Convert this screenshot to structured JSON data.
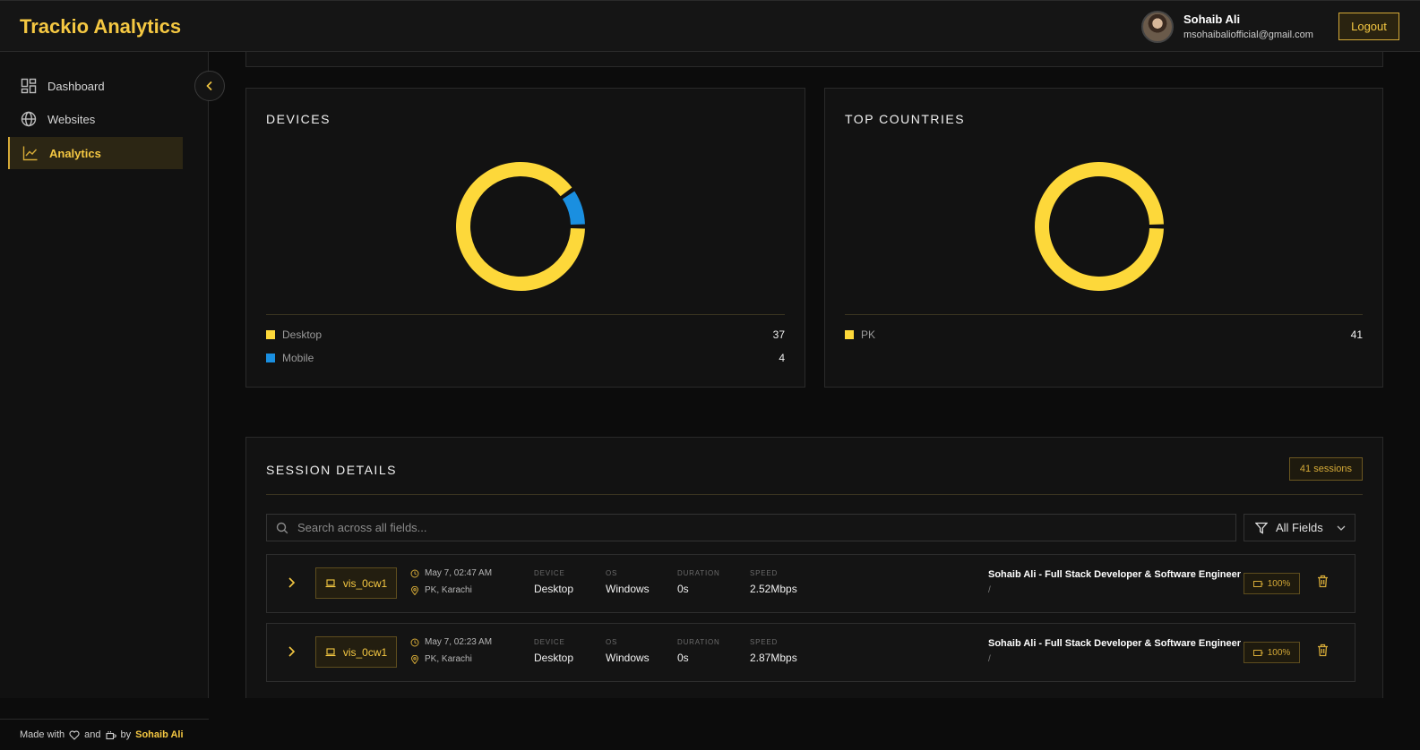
{
  "app": {
    "title": "Trackio Analytics"
  },
  "user": {
    "name": "Sohaib Ali",
    "email": "msohaibaliofficial@gmail.com",
    "logout_label": "Logout"
  },
  "sidebar": {
    "items": [
      {
        "label": "Dashboard",
        "icon": "dashboard-icon"
      },
      {
        "label": "Websites",
        "icon": "globe-icon"
      },
      {
        "label": "Analytics",
        "icon": "chart-icon",
        "active": true
      }
    ],
    "footer": {
      "made_with": "Made with",
      "and": "and",
      "by": "by",
      "author": "Sohaib Ali"
    }
  },
  "devices": {
    "title": "DEVICES",
    "items": [
      {
        "label": "Desktop",
        "value": "37",
        "color": "#fdd83a"
      },
      {
        "label": "Mobile",
        "value": "4",
        "color": "#1a8fe0"
      }
    ]
  },
  "countries": {
    "title": "TOP COUNTRIES",
    "items": [
      {
        "label": "PK",
        "value": "41",
        "color": "#fdd83a"
      }
    ]
  },
  "chart_data": [
    {
      "type": "pie",
      "title": "DEVICES",
      "categories": [
        "Desktop",
        "Mobile"
      ],
      "values": [
        37,
        4
      ]
    },
    {
      "type": "pie",
      "title": "TOP COUNTRIES",
      "categories": [
        "PK"
      ],
      "values": [
        41
      ]
    }
  ],
  "sessions": {
    "title": "SESSION DETAILS",
    "count_label": "41 sessions",
    "search_placeholder": "Search across all fields...",
    "filter_label": "All Fields",
    "col_labels": {
      "device": "DEVICE",
      "os": "OS",
      "duration": "DURATION",
      "speed": "SPEED"
    },
    "rows": [
      {
        "visitor": "vis_0cw1",
        "time": "May 7, 02:47 AM",
        "location": "PK, Karachi",
        "device": "Desktop",
        "os": "Windows",
        "duration": "0s",
        "speed": "2.52Mbps",
        "page_title": "Sohaib Ali - Full Stack Developer & Software Engineer",
        "path": "/",
        "battery": "100%"
      },
      {
        "visitor": "vis_0cw1",
        "time": "May 7, 02:23 AM",
        "location": "PK, Karachi",
        "device": "Desktop",
        "os": "Windows",
        "duration": "0s",
        "speed": "2.87Mbps",
        "page_title": "Sohaib Ali - Full Stack Developer & Software Engineer",
        "path": "/",
        "battery": "100%"
      }
    ]
  }
}
